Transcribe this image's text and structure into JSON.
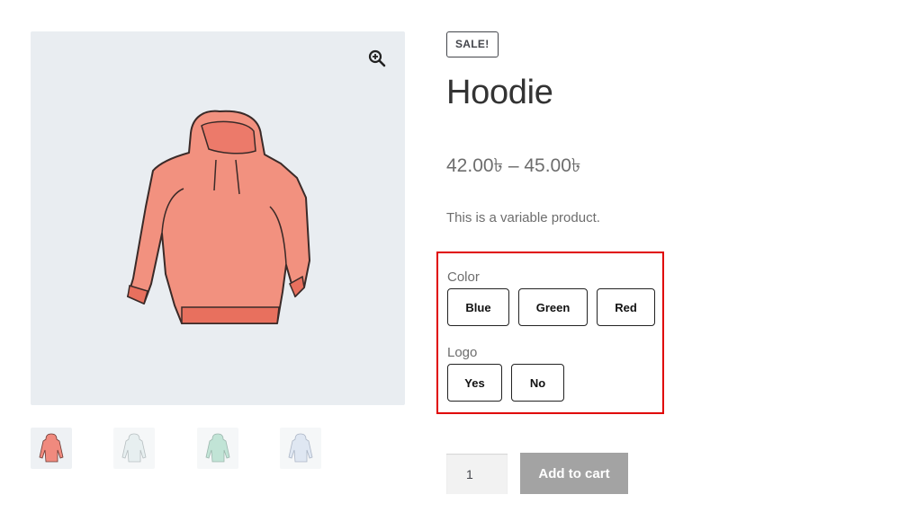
{
  "product": {
    "badge": "SALE!",
    "title": "Hoodie",
    "price": "42.00৳ – 45.00৳",
    "description": "This is a variable product."
  },
  "gallery": {
    "zoom_icon": "zoom-in-icon",
    "main_image_icon": "hoodie-image",
    "thumbnails": [
      {
        "icon": "hoodie-red-thumbnail",
        "color": "#f08a7e"
      },
      {
        "icon": "hoodie-grey-thumbnail",
        "color": "#b8c8cc"
      },
      {
        "icon": "hoodie-green-thumbnail",
        "color": "#8fcfb6"
      },
      {
        "icon": "hoodie-blue-thumbnail",
        "color": "#a8bcd8"
      }
    ]
  },
  "variations": {
    "color": {
      "label": "Color",
      "options": [
        "Blue",
        "Green",
        "Red"
      ]
    },
    "logo": {
      "label": "Logo",
      "options": [
        "Yes",
        "No"
      ]
    },
    "highlight_color": "#e00000"
  },
  "cart": {
    "quantity": "1",
    "add_to_cart_label": "Add to cart",
    "button_color": "#a3a3a3"
  }
}
